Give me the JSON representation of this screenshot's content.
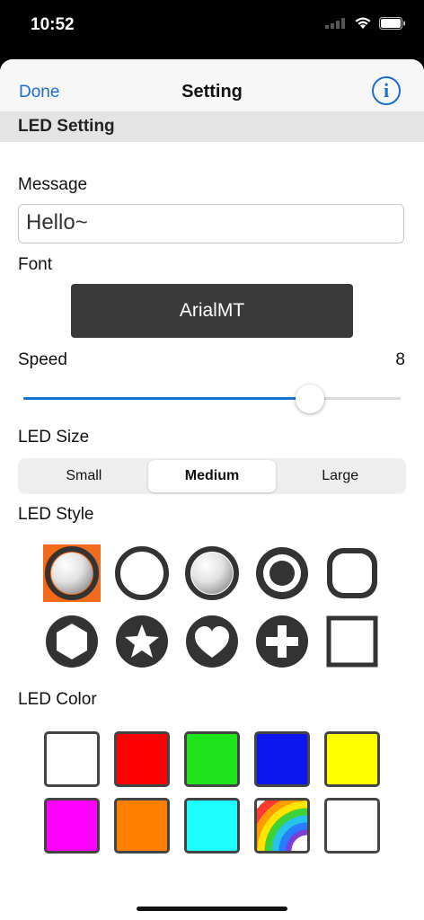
{
  "status": {
    "time": "10:52"
  },
  "nav": {
    "done_label": "Done",
    "title": "Setting",
    "info_symbol": "i"
  },
  "section_title": "LED Setting",
  "message": {
    "label": "Message",
    "value": "Hello~"
  },
  "font": {
    "label": "Font",
    "value": "ArialMT"
  },
  "speed": {
    "label": "Speed",
    "value": "8",
    "fraction": 0.76
  },
  "led_size": {
    "label": "LED Size",
    "options": [
      "Small",
      "Medium",
      "Large"
    ],
    "selected": "Medium"
  },
  "led_style": {
    "label": "LED Style",
    "selected_index": 0,
    "selected_color": "#f26b1d",
    "styles": [
      "sphere-ring",
      "ring",
      "sphere",
      "dot-ring",
      "rounded-square",
      "hexagon",
      "star",
      "heart",
      "plus",
      "square"
    ]
  },
  "led_color": {
    "label": "LED Color",
    "swatches": [
      "#ffffff",
      "#ff0000",
      "#1ee41b",
      "#0d15ee",
      "#ffff00",
      "#ff00ff",
      "#ff7f00",
      "#1ffcff",
      "rainbow",
      "#ffffff"
    ]
  }
}
